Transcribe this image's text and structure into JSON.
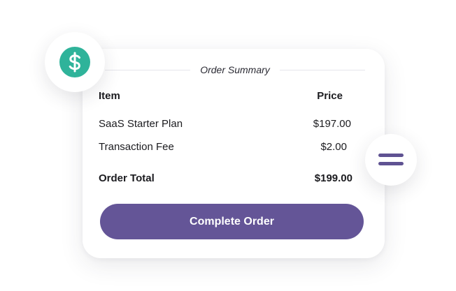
{
  "order_summary": {
    "title": "Order Summary",
    "columns": {
      "item": "Item",
      "price": "Price"
    },
    "items": [
      {
        "name": "SaaS Starter Plan",
        "price": "$197.00"
      },
      {
        "name": "Transaction Fee",
        "price": "$2.00"
      }
    ],
    "total": {
      "label": "Order Total",
      "value": "$199.00"
    },
    "button_label": "Complete Order"
  },
  "icons": {
    "badge_left": "dollar-icon",
    "badge_right": "menu-icon"
  },
  "colors": {
    "accent": "#645597",
    "dollar_circle": "#2fb39a",
    "menu_bars": "#5f5292"
  }
}
